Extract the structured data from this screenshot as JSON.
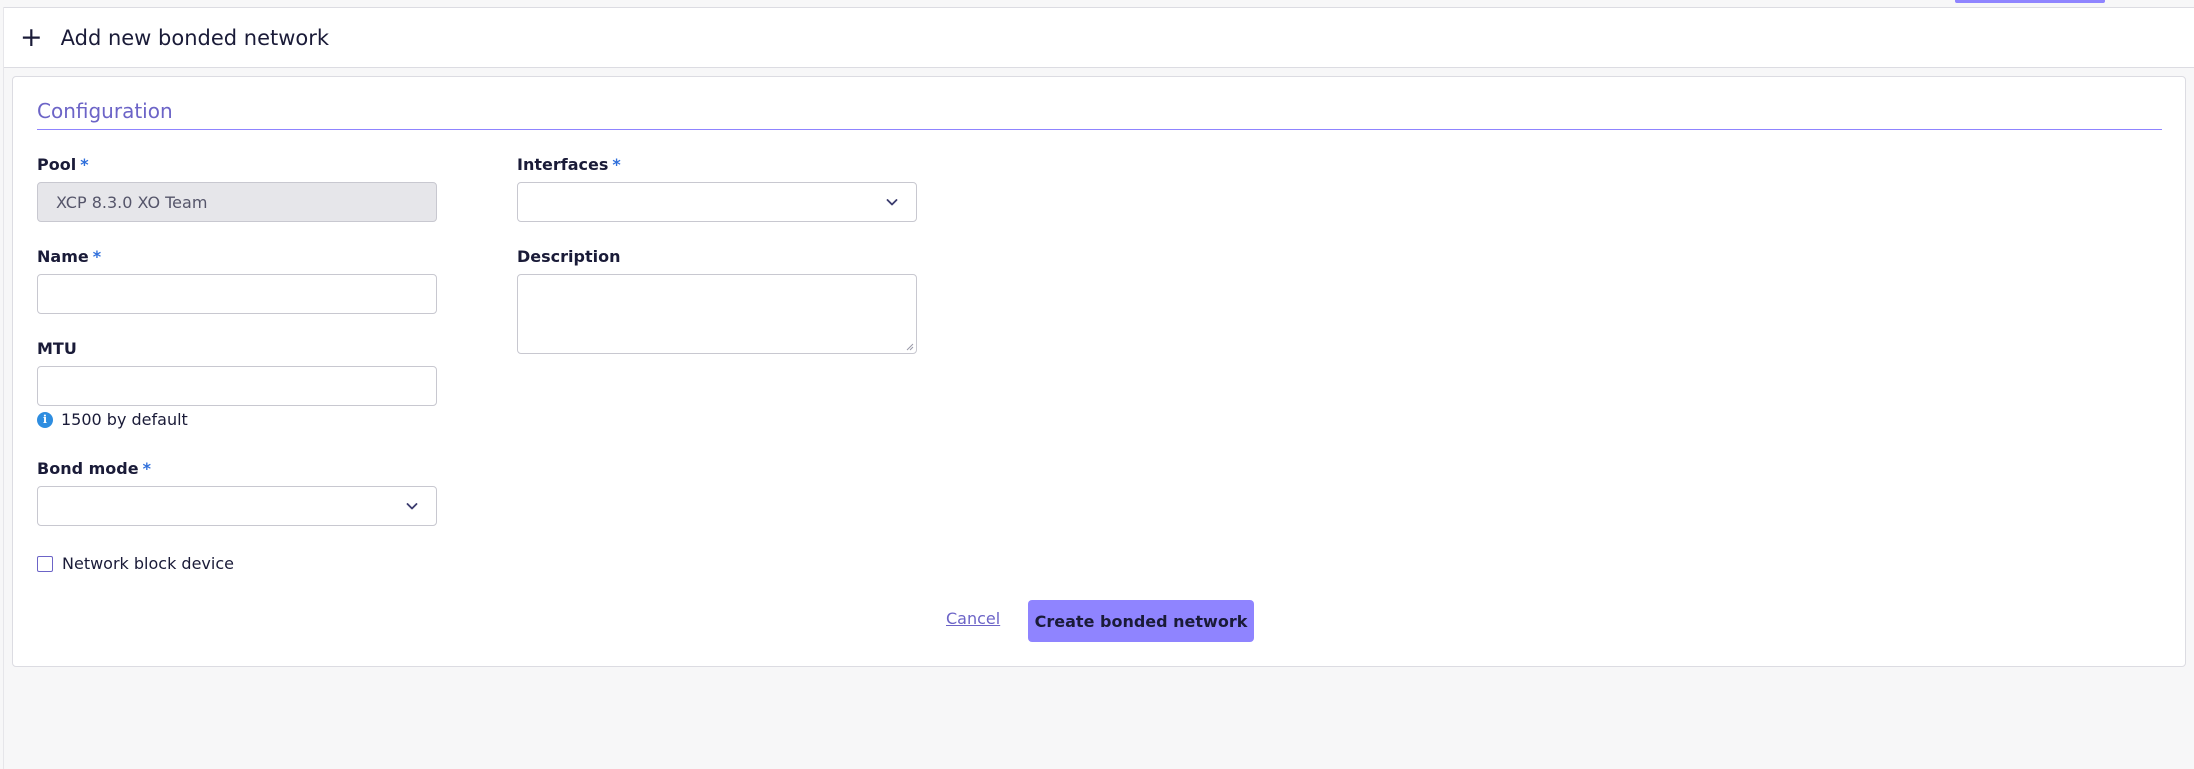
{
  "header": {
    "icon": "plus-icon",
    "title": "Add new bonded network"
  },
  "form": {
    "section_title": "Configuration",
    "required_marker": "*",
    "pool": {
      "label": "Pool",
      "value": "XCP 8.3.0 XO Team",
      "disabled": true
    },
    "name": {
      "label": "Name",
      "value": ""
    },
    "mtu": {
      "label": "MTU",
      "value": "",
      "hint": "1500 by default"
    },
    "bond_mode": {
      "label": "Bond mode",
      "value": ""
    },
    "interfaces": {
      "label": "Interfaces",
      "value": ""
    },
    "description": {
      "label": "Description",
      "value": ""
    },
    "network_block_device": {
      "label": "Network block device",
      "checked": false
    }
  },
  "actions": {
    "cancel_label": "Cancel",
    "submit_label": "Create bonded network"
  },
  "colors": {
    "accent": "#8f84ff",
    "section_title": "#6c64c7",
    "required": "#2f6fdb",
    "info": "#2e8de0"
  }
}
